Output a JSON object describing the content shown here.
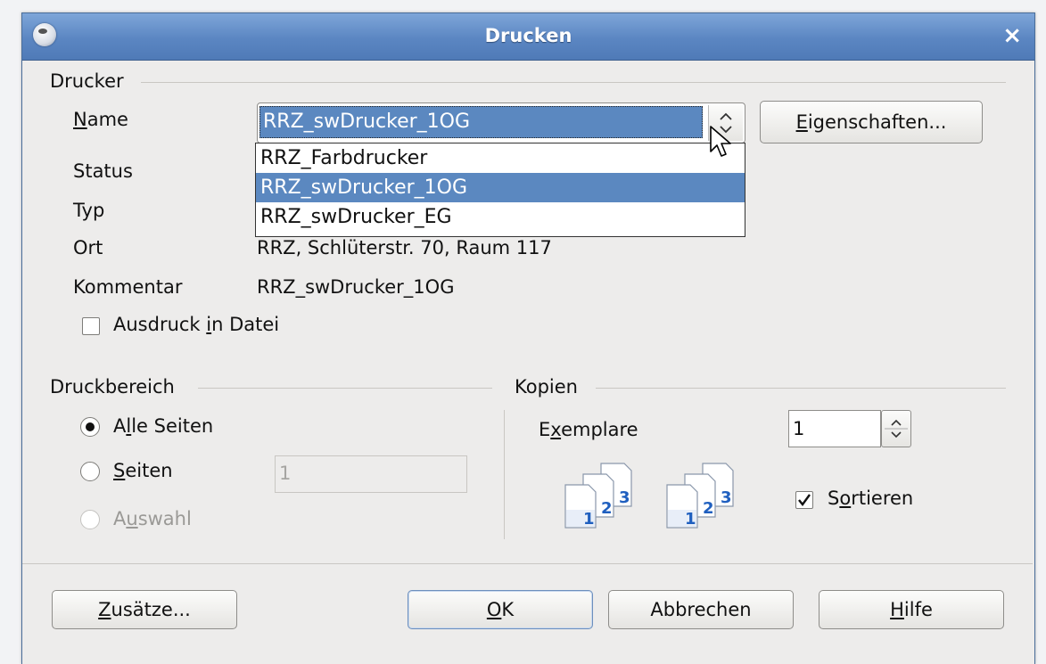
{
  "window": {
    "title": "Drucken",
    "close_glyph": "×"
  },
  "printer": {
    "section_title": "Drucker",
    "name_label_u": "N",
    "name_label_rest": "ame",
    "selected": "RRZ_swDrucker_1OG",
    "options": [
      "RRZ_Farbdrucker",
      "RRZ_swDrucker_1OG",
      "RRZ_swDrucker_EG"
    ],
    "properties_u": "E",
    "properties_rest": "igenschaften...",
    "status_label": "Status",
    "type_label": "Typ",
    "location_label": "Ort",
    "location_value": "RRZ, Schlüterstr. 70, Raum 117",
    "comment_label": "Kommentar",
    "comment_value": "RRZ_swDrucker_1OG",
    "print_to_file_a": "Ausdruck ",
    "print_to_file_u": "i",
    "print_to_file_b": "n Datei",
    "print_to_file_checked": false
  },
  "range": {
    "section_title": "Druckbereich",
    "all_a": "A",
    "all_u": "l",
    "all_b": "le Seiten",
    "pages_u": "S",
    "pages_rest": "eiten",
    "pages_value": "1",
    "selection_a": "A",
    "selection_u": "u",
    "selection_b": "swahl"
  },
  "copies": {
    "section_title": "Kopien",
    "count_a": "E",
    "count_u": "x",
    "count_b": "emplare",
    "count_value": "1",
    "sort_a": "S",
    "sort_u": "o",
    "sort_b": "rtieren",
    "sort_checked": true,
    "stack_numbers": [
      "1",
      "2",
      "3"
    ]
  },
  "buttons": {
    "options_u": "Z",
    "options_rest": "usätze...",
    "ok_u": "O",
    "ok_rest": "K",
    "cancel": "Abbrechen",
    "help_u": "H",
    "help_rest": "ilfe"
  },
  "colors": {
    "titlebar": "#5b86c2",
    "selection": "#5b88c0",
    "number_blue": "#1f5fbf"
  }
}
